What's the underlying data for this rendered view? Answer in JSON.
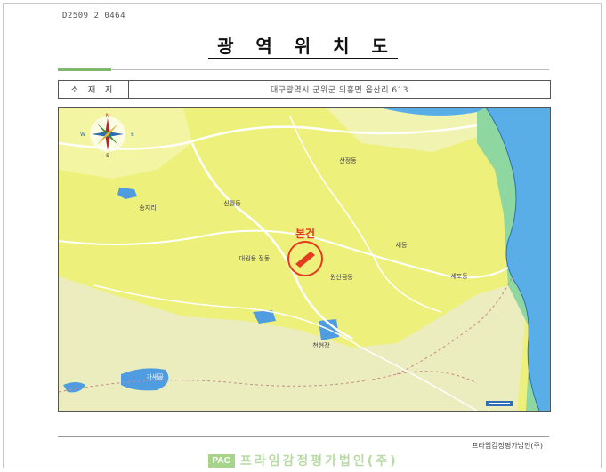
{
  "document": {
    "doc_number": "D2509 2 0464",
    "title": "광 역 위 치 도"
  },
  "location": {
    "label": "소 재 지",
    "value": "대구광역시 군위군 의흥면 읍산리 613"
  },
  "map": {
    "site_label": "본건",
    "compass": {
      "north": "N",
      "west": "W",
      "east": "E",
      "south": "S"
    },
    "place_labels": [
      "산정동",
      "송지리",
      "신월동",
      "세동",
      "세포동",
      "원산금동",
      "대원용 정동",
      "가새골",
      "천현장"
    ],
    "colors": {
      "land": "#f2f07a",
      "urban": "#e6e9b4",
      "water": "#4fa3e6",
      "river_bank": "#6fcf8f",
      "site_marker": "#e23b1e"
    }
  },
  "footer": {
    "company_small": "프라임감정평가법인(주)",
    "logo_abbrev": "PAC",
    "logo_name": "프라임감정평가법인(주)"
  }
}
